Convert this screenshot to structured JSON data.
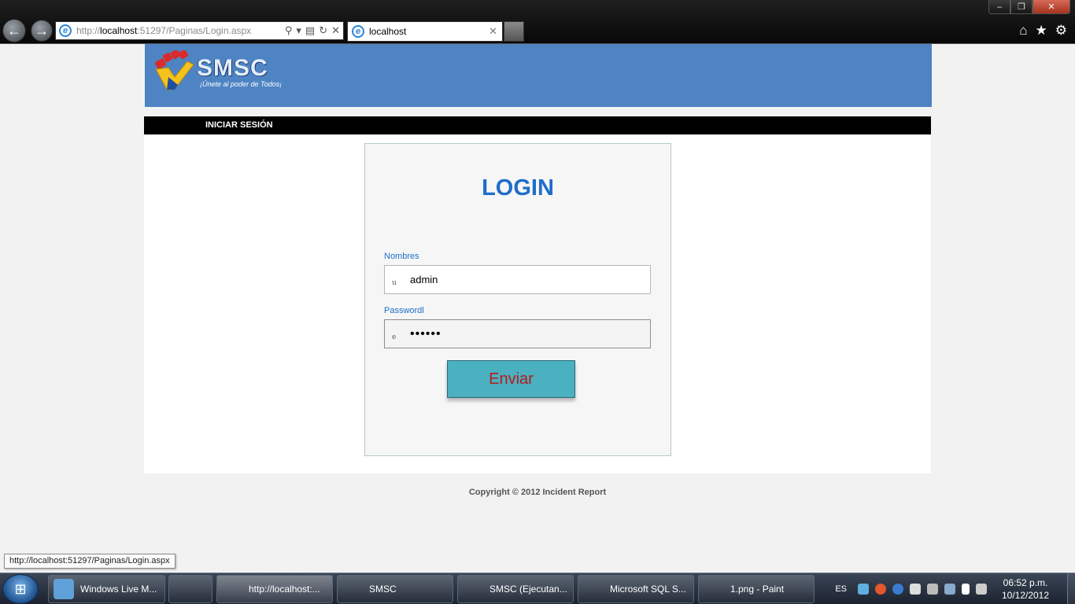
{
  "browser": {
    "address": {
      "prefix": "http://",
      "host": "localhost",
      "rest": ":51297/Paginas/Login.aspx"
    },
    "tab_title": "localhost",
    "window_controls": [
      "–",
      "❐",
      "✕"
    ]
  },
  "site": {
    "logo_text": "SMSC",
    "slogan": "¡Únete al poder de Todos¡",
    "nav": {
      "login": "INICIAR SESIÓN"
    },
    "login": {
      "title": "LOGIN",
      "user_label": "Nombres",
      "user_icon": "u",
      "user_value": "admin",
      "password_label": "Passwordl",
      "password_icon": "e",
      "password_value": "••••••",
      "submit_label": "Enviar"
    },
    "copyright": "Copyright © 2012 Incident Report",
    "status_url": "http://localhost:51297/Paginas/Login.aspx"
  },
  "taskbar": {
    "items": [
      {
        "label": "Windows Live M...",
        "icon_color": "#5fa0d8"
      },
      {
        "label": "",
        "icon_color": "#e8452c"
      },
      {
        "label": "http://localhost:...",
        "icon_color": "#2b84d8"
      },
      {
        "label": "SMSC",
        "icon_color": "#e9c760"
      },
      {
        "label": "SMSC (Ejecutan...",
        "icon_color": "#7a5bb5"
      },
      {
        "label": "Microsoft SQL S...",
        "icon_color": "#c9a24a"
      },
      {
        "label": "1.png - Paint",
        "icon_color": "#e0a050"
      }
    ],
    "language": "ES",
    "time": "06:52 p.m.",
    "date": "10/12/2012"
  },
  "colors": {
    "banner": "#4e84c3",
    "accent": "#1f6dc9",
    "button": "#4bb0c0",
    "button_text": "#b31b1b"
  }
}
